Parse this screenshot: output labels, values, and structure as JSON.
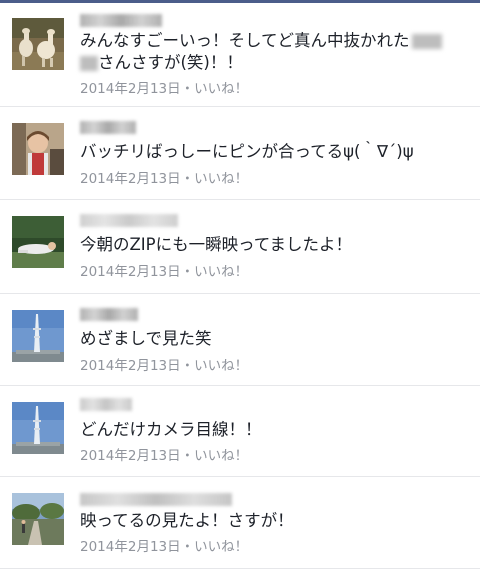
{
  "comments": [
    {
      "line1": "みんなすごーいっ！そしてど真ん中抜かれた",
      "line2": "さんさすが(笑)！！",
      "date": "2014年2月13日",
      "sep": "・",
      "like": "いいね！"
    },
    {
      "line1": "バッチリばっしーにピンが合ってるψ(｀∇´)ψ",
      "date": "2014年2月13日",
      "sep": "・",
      "like": "いいね！"
    },
    {
      "line1": "今朝のZIPにも一瞬映ってましたよ！",
      "date": "2014年2月13日",
      "sep": "・",
      "like": "いいね！"
    },
    {
      "line1": "めざましで見た笑",
      "date": "2014年2月13日",
      "sep": "・",
      "like": "いいね！"
    },
    {
      "line1": "どんだけカメラ目線！！",
      "date": "2014年2月13日",
      "sep": "・",
      "like": "いいね！"
    },
    {
      "line1": "映ってるの見たよ！さすが！",
      "date": "2014年2月13日",
      "sep": "・",
      "like": "いいね！"
    }
  ],
  "colors": {
    "text": "#1d2129",
    "meta": "#90949c",
    "divider": "#e6e7ea",
    "topbar": "#4b5d8a"
  },
  "icons": [
    "avatar-alpacas",
    "avatar-woman",
    "avatar-person-lying",
    "avatar-tokyo-skytree",
    "avatar-tokyo-skytree",
    "avatar-park-path"
  ]
}
